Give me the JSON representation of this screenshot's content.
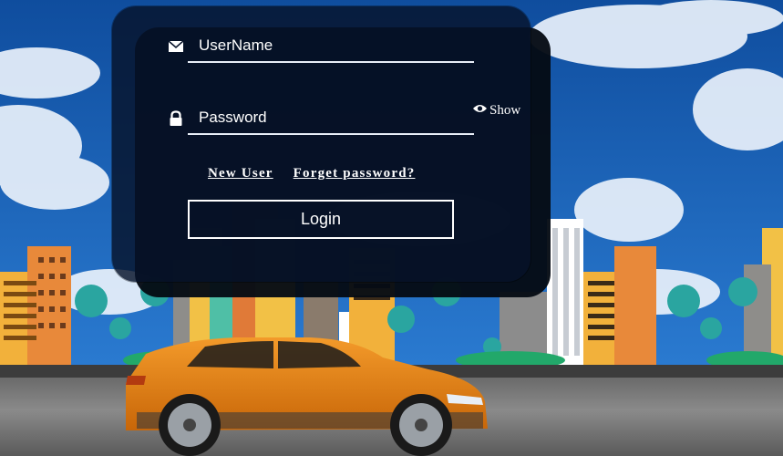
{
  "login": {
    "username_placeholder": "UserName",
    "password_placeholder": "Password",
    "show_label": "Show",
    "new_user_link": "New User",
    "forgot_link": "Forget password?",
    "login_button": "Login"
  },
  "theme": {
    "sky": "#1b5fb0",
    "card": "#061229",
    "text": "#ffffff",
    "car_body": "#e07c12"
  }
}
